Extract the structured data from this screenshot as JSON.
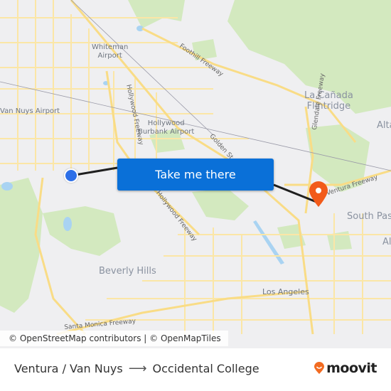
{
  "map": {
    "labels": [
      {
        "id": "whiteman-airport",
        "text": "Whiteman\nAirport",
        "type": "small"
      },
      {
        "id": "van-nuys-airport",
        "text": "Van Nuys Airport",
        "type": "small"
      },
      {
        "id": "hollywood-burbank-airport",
        "text": "Hollywood\nBurbank Airport",
        "type": "small"
      },
      {
        "id": "la-canada-flintridge",
        "text": "La Cañada\nFlintridge",
        "type": "city"
      },
      {
        "id": "altadena",
        "text": "Alta",
        "type": "city"
      },
      {
        "id": "south-pasadena",
        "text": "South Pas",
        "type": "city"
      },
      {
        "id": "alhambra",
        "text": "Al",
        "type": "city"
      },
      {
        "id": "beverly-hills",
        "text": "Beverly Hills",
        "type": "city"
      },
      {
        "id": "los-angeles",
        "text": "Los Angeles",
        "type": "small"
      },
      {
        "id": "foothill-freeway",
        "text": "Foothill Freeway",
        "type": "road"
      },
      {
        "id": "hollywood-freeway-north",
        "text": "Hollywood Freeway",
        "type": "road"
      },
      {
        "id": "hollywood-freeway-south",
        "text": "Hollywood Freeway",
        "type": "road"
      },
      {
        "id": "golden-state",
        "text": "Golden St",
        "type": "road"
      },
      {
        "id": "glendale-freeway",
        "text": "Glendale Freeway",
        "type": "road"
      },
      {
        "id": "ventura-freeway",
        "text": "Ventura Freeway",
        "type": "road"
      },
      {
        "id": "santa-monica-freeway",
        "text": "Santa Monica Freeway",
        "type": "road"
      }
    ],
    "cta_label": "Take me there",
    "attribution": {
      "osm": "© OpenStreetMap contributors",
      "separator": " | ",
      "omt": "© OpenMapTiles"
    },
    "colors": {
      "route_line": "#1f1f1f",
      "origin_dot": "#2d6fe8",
      "destination_pin": "#f25a1a",
      "cta_bg": "#0a70d8",
      "park": "#cfe8b8",
      "road": "#fde8a8",
      "water": "#a9d3f2"
    }
  },
  "footer": {
    "origin": "Ventura / Van Nuys",
    "arrow": "⟶",
    "destination": "Occidental College",
    "brand": "moovit",
    "brand_color": "#f26b21"
  }
}
